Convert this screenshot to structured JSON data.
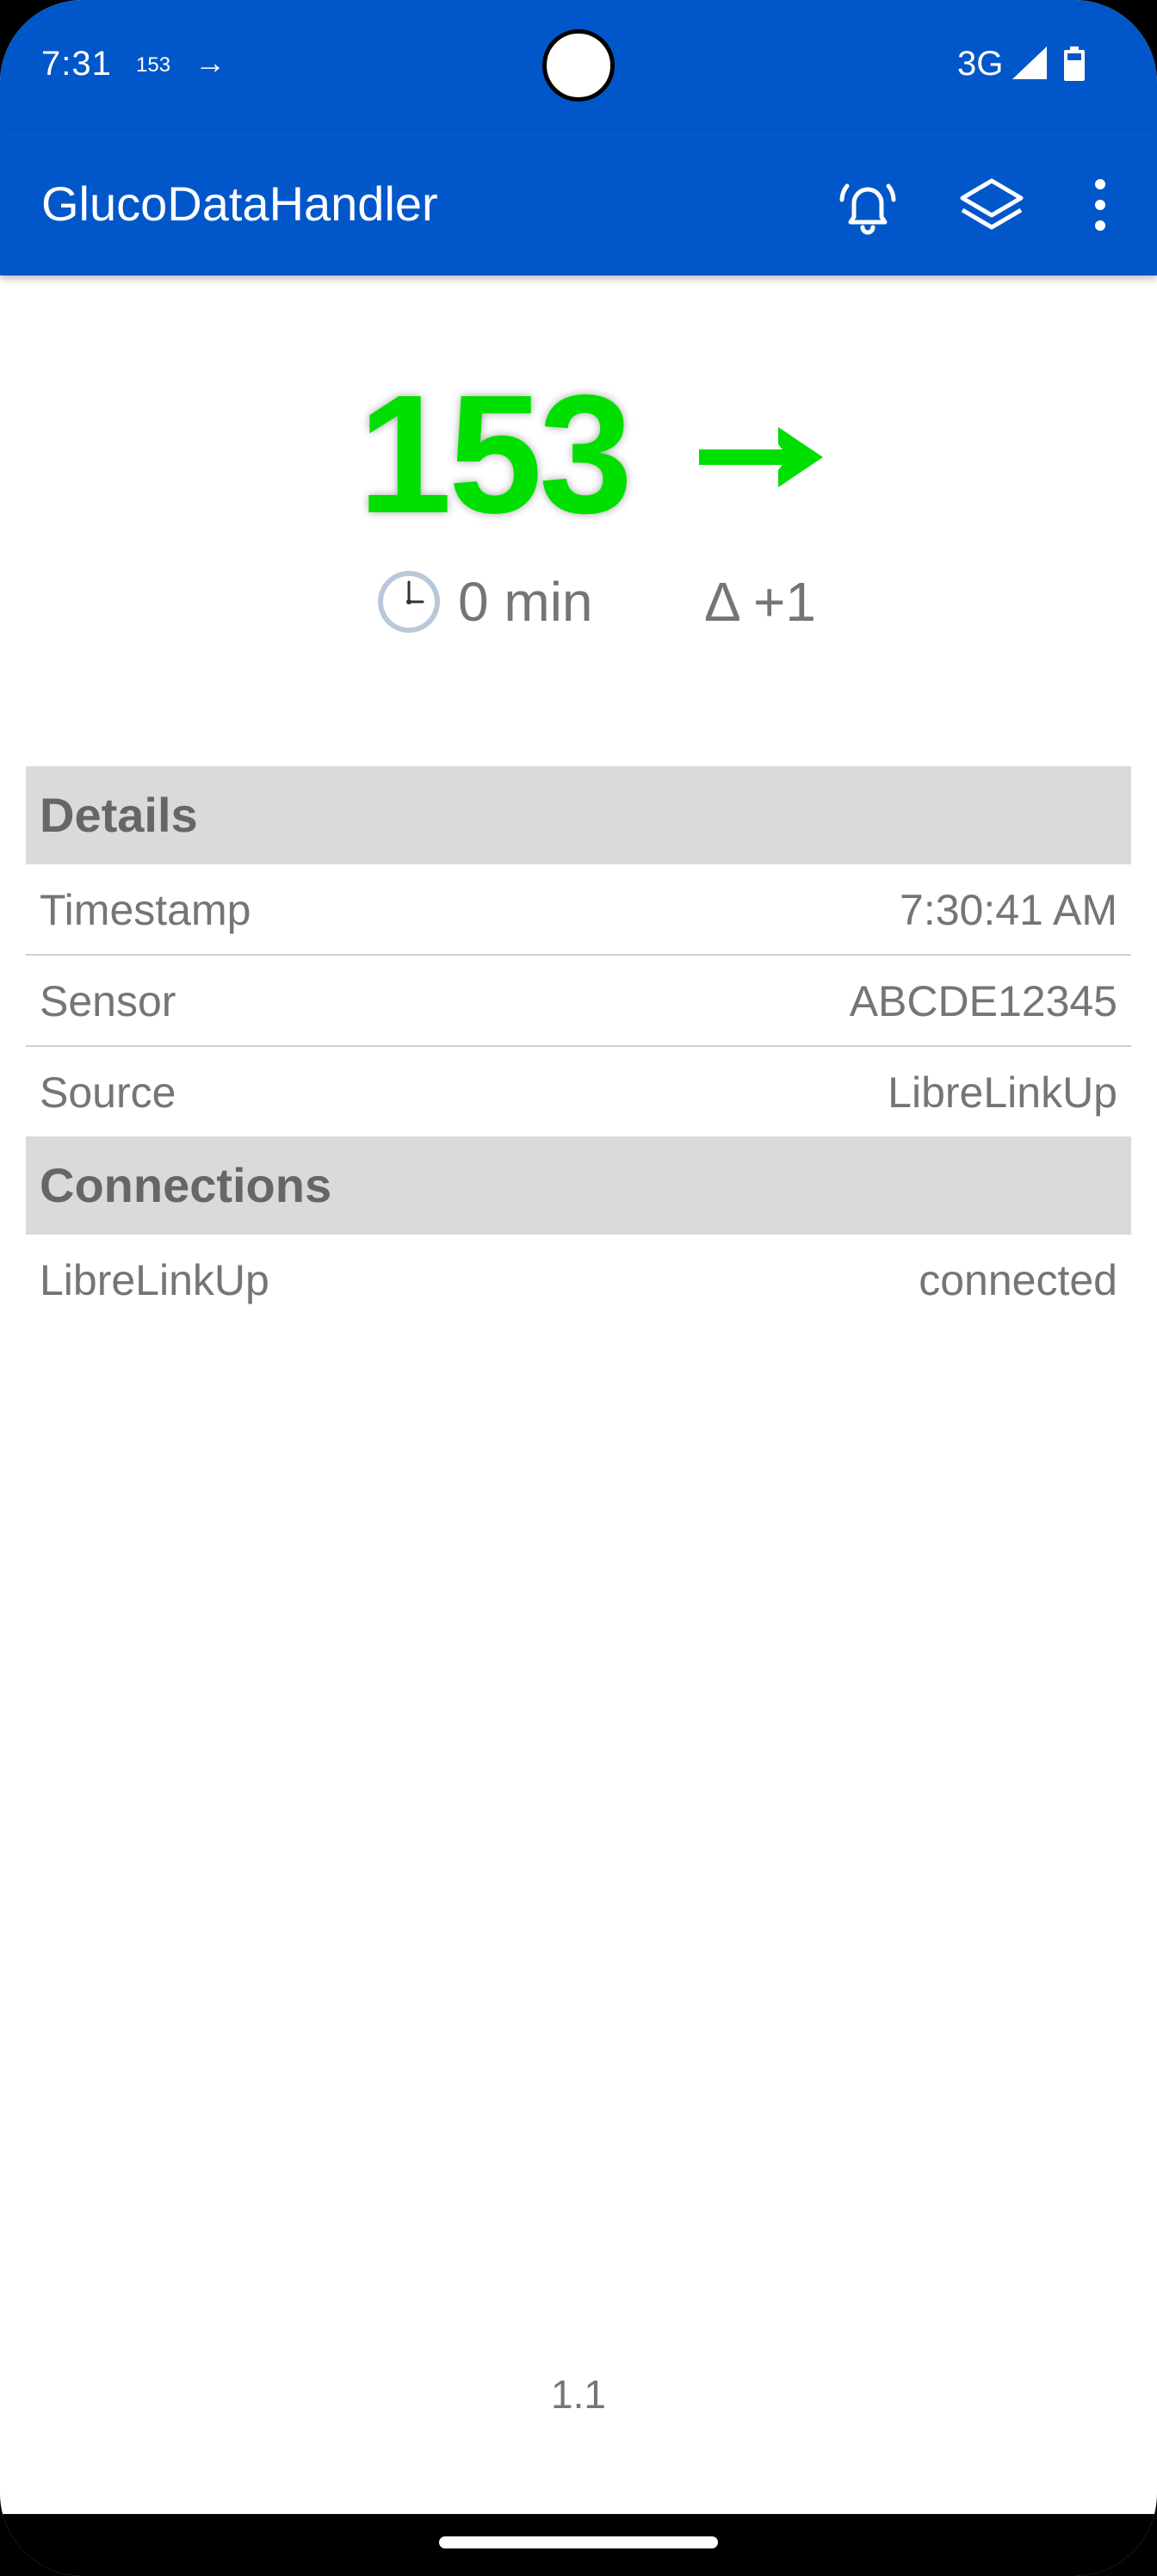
{
  "status_bar": {
    "time": "7:31",
    "glucose": "153",
    "trend": "→",
    "network": "3G"
  },
  "app_bar": {
    "title": "GlucoDataHandler"
  },
  "reading": {
    "value": "153",
    "trend_direction": "flat",
    "elapsed": "0 min",
    "delta": "Δ +1",
    "color": "#00e000"
  },
  "details": {
    "header": "Details",
    "rows": [
      {
        "label": "Timestamp",
        "value": "7:30:41 AM"
      },
      {
        "label": "Sensor",
        "value": "ABCDE12345"
      },
      {
        "label": "Source",
        "value": "LibreLinkUp"
      }
    ]
  },
  "connections": {
    "header": "Connections",
    "rows": [
      {
        "label": "LibreLinkUp",
        "value": "connected"
      }
    ]
  },
  "version": "1.1",
  "colors": {
    "primary": "#0157c9",
    "section_bg": "#dadada"
  },
  "icons": [
    "alarm-bell-icon",
    "layers-icon",
    "more-vert-icon",
    "clock-icon",
    "trend-arrow-icon",
    "signal-icon",
    "battery-icon"
  ]
}
